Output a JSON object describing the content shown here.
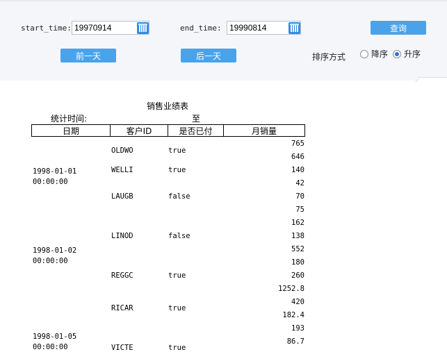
{
  "filters": {
    "start_label": "start_time:",
    "start_value": "19970914",
    "end_label": "end_time:",
    "end_value": "19990814",
    "query_button": "查询",
    "prev_day_button": "前一天",
    "next_day_button": "后一天",
    "sort_label": "排序方式",
    "sort_options": [
      "降序",
      "升序"
    ],
    "sort_selected": "升序"
  },
  "report": {
    "title": "销售业绩表",
    "stat_label": "统计时间:",
    "stat_to": "至",
    "columns": [
      "日期",
      "客户ID",
      "是否已付",
      "月销量"
    ],
    "dates": [
      {
        "line1": "1998-01-01",
        "line2": "00:00:00"
      },
      {
        "line1": "1998-01-02",
        "line2": "00:00:00"
      },
      {
        "line1": "1998-01-05",
        "line2": "00:00:00"
      }
    ],
    "customers": [
      {
        "id": "OLDWO",
        "paid": "true"
      },
      {
        "id": "WELLI",
        "paid": "true"
      },
      {
        "id": "LAUGB",
        "paid": "false"
      },
      {
        "id": "LINOD",
        "paid": "false"
      },
      {
        "id": "REGGC",
        "paid": "true"
      },
      {
        "id": "RICAR",
        "paid": "true"
      },
      {
        "id": "VICTE",
        "paid": "true"
      }
    ],
    "sales": [
      "765",
      "646",
      "140",
      "42",
      "70",
      "75",
      "162",
      "138",
      "552",
      "180",
      "260",
      "1252.8",
      "420",
      "182.4",
      "193",
      "86.7"
    ]
  }
}
